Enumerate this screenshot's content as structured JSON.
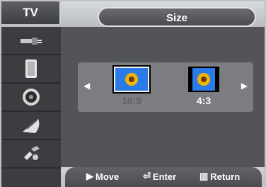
{
  "header": {
    "section_label": "TV",
    "title": "Size"
  },
  "sidebar": {
    "items": [
      {
        "icon": "antenna-plug-icon"
      },
      {
        "icon": "picture-speaker-icon"
      },
      {
        "icon": "sound-speaker-icon"
      },
      {
        "icon": "satellite-dish-icon"
      },
      {
        "icon": "setup-tools-icon"
      }
    ]
  },
  "options": [
    {
      "label": "16:9",
      "selected": false
    },
    {
      "label": "4:3",
      "selected": true
    }
  ],
  "footer": {
    "move_label": "Move",
    "enter_label": "Enter",
    "return_label": "Return"
  },
  "colors": {
    "menu_bg": "#545557",
    "sidebar_bg": "#3b3d40",
    "panel_bg": "#7b7d80",
    "frame": "#bfc3c7"
  }
}
